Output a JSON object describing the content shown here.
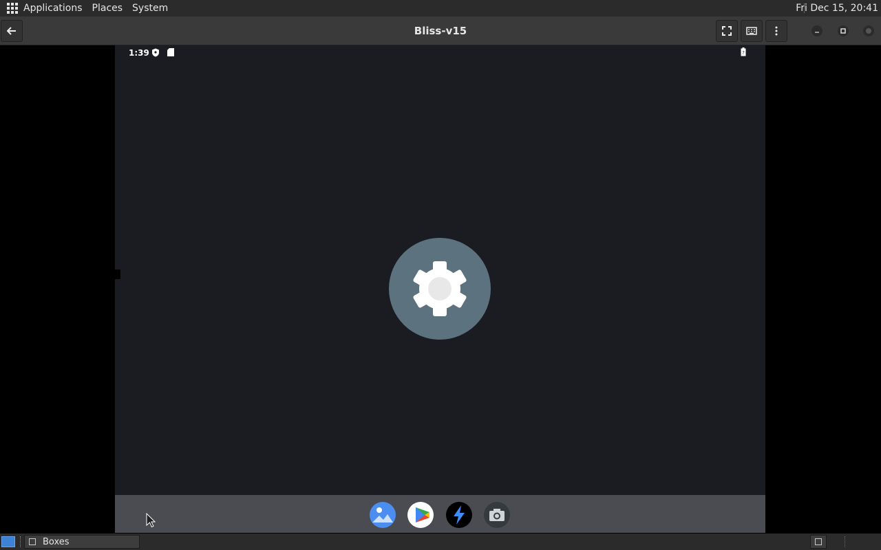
{
  "top_panel": {
    "menus": [
      "Applications",
      "Places",
      "System"
    ],
    "clock": "Fri Dec 15, 20:41"
  },
  "header": {
    "title": "Bliss-v15"
  },
  "vm": {
    "status_time": "1:39",
    "settings_color": "#5c727e",
    "background_color": "#1b1c22",
    "dock_icons": [
      "gallery-icon",
      "play-store-icon",
      "flash-icon",
      "camera-icon"
    ]
  },
  "taskbar": {
    "task_label": "Boxes"
  }
}
